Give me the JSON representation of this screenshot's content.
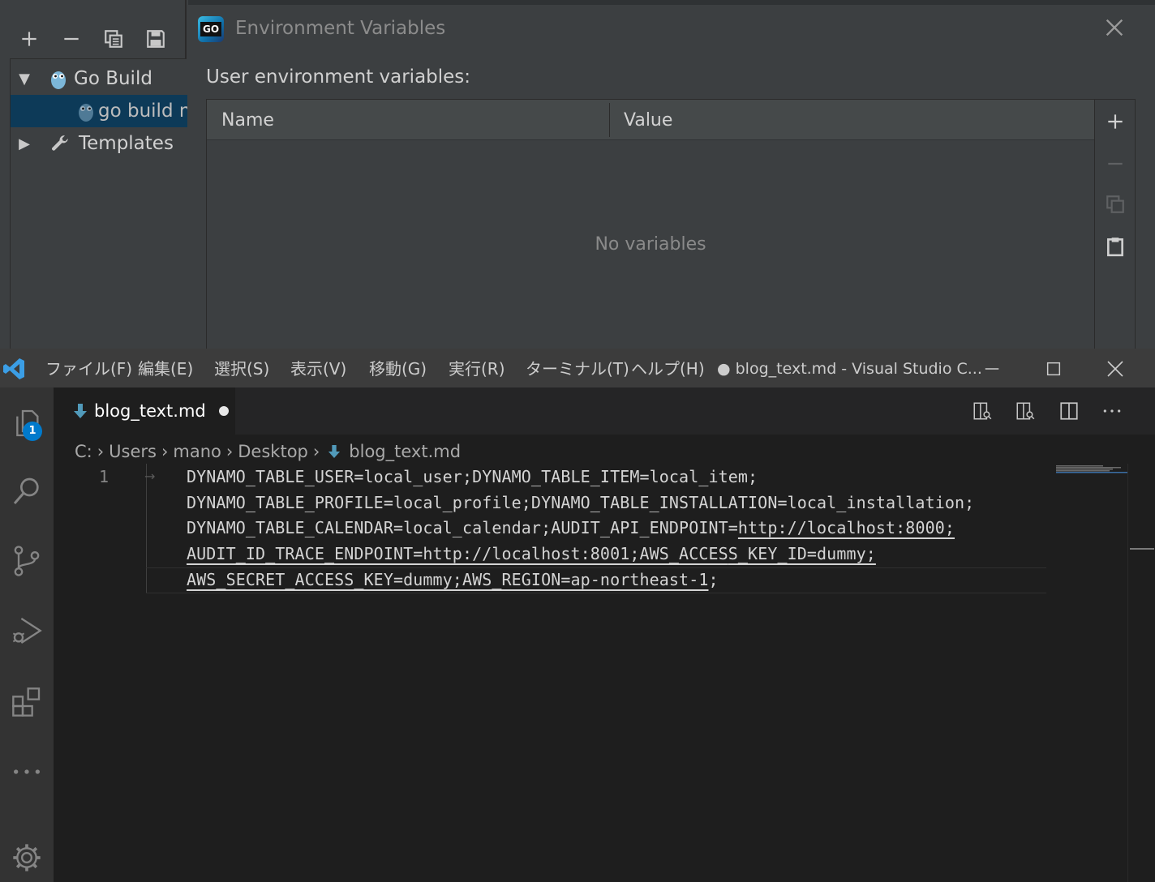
{
  "ide": {
    "tree": {
      "go_build": "Go Build",
      "go_build_child": "go build m",
      "templates": "Templates"
    },
    "env_dialog": {
      "title": "Environment Variables",
      "label": "User environment variables:",
      "columns": [
        "Name",
        "Value"
      ],
      "empty_text": "No variables",
      "logo_text": "GO"
    }
  },
  "vscode": {
    "menu": [
      "ファイル(F)",
      "編集(E)",
      "選択(S)",
      "表示(V)",
      "移動(G)",
      "実行(R)",
      "ターミナル(T)",
      "ヘルプ(H)"
    ],
    "window_title": "● blog_text.md - Visual Studio C...",
    "badge_count": "1",
    "tab": {
      "label": "blog_text.md"
    },
    "breadcrumb": [
      "C:",
      "Users",
      "mano",
      "Desktop",
      "blog_text.md"
    ],
    "line_number": "1",
    "code": {
      "line1": "DYNAMO_TABLE_USER=local_user;DYNAMO_TABLE_ITEM=local_item;",
      "line2": "DYNAMO_TABLE_PROFILE=local_profile;DYNAMO_TABLE_INSTALLATION=local_installation;",
      "line3_a": "DYNAMO_TABLE_CALENDAR=local_calendar;AUDIT_API_ENDPOINT=",
      "line3_link": "http://localhost:8000;",
      "line4_link1": "AUDIT_ID_TRACE_ENDPOINT=http://localhost:8001;AWS_ACCES",
      "line4_link2": "S_KEY_ID=dummy;",
      "line5_link": "AWS_SECRET_ACCESS_KEY=dummy;AWS_REGION=ap-northeast-1",
      "line5_end": ";"
    }
  }
}
